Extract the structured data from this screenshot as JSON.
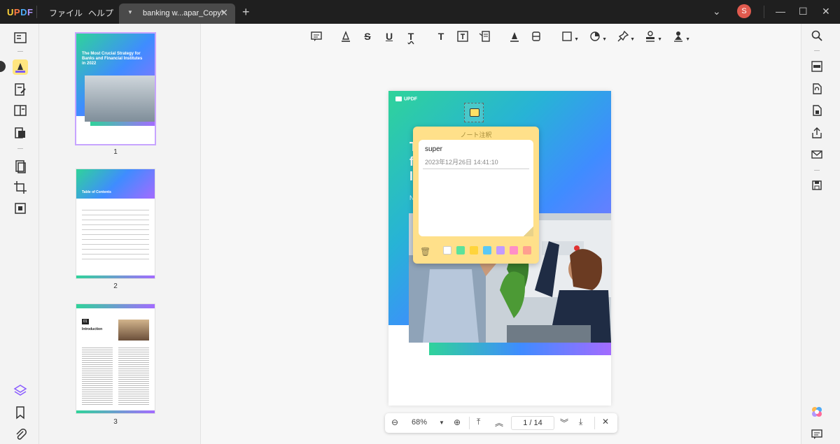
{
  "app": {
    "logo": "UPDF"
  },
  "menu": {
    "file": "ファイル",
    "help": "ヘルプ"
  },
  "tab": {
    "title": "banking w...apar_Copy*"
  },
  "user": {
    "initial": "S"
  },
  "thumbnails": [
    {
      "page": "1",
      "title": "The Most Crucial Strategy for Banks and Financial Institutes in 2022"
    },
    {
      "page": "2",
      "title": "Table of Contents"
    },
    {
      "page": "3",
      "number": "01",
      "title": "Introduction"
    }
  ],
  "document": {
    "brand": "UPDF",
    "title_visible": "T                        tegy\nf                               al\nI",
    "subtitle_visible": "N                                    s"
  },
  "note": {
    "header": "ノート注釈",
    "author": "super",
    "timestamp": "2023年12月26日 14:41:10",
    "colors": [
      "#ffffff",
      "#5ce29b",
      "#ffd43b",
      "#5ac8f5",
      "#c39bff",
      "#ff8fc7",
      "#ff9f8f"
    ]
  },
  "pagebar": {
    "zoom": "68%",
    "current_page": "1",
    "separator": "/",
    "total_pages": "14"
  }
}
